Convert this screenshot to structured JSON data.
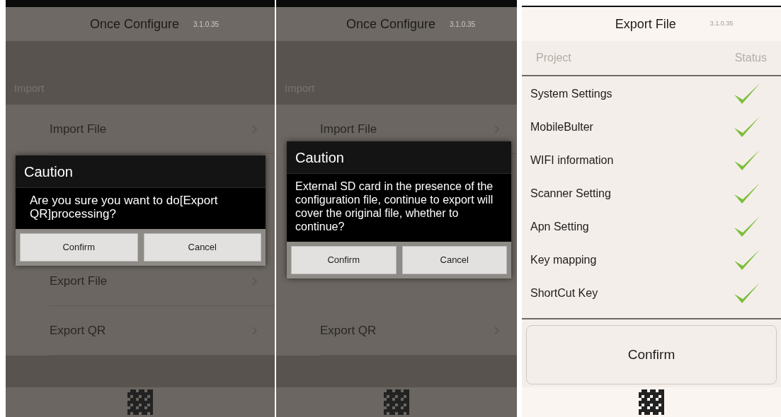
{
  "screens": [
    {
      "kind": "menu",
      "title": "Once Configure",
      "version": "3.1.0.35",
      "section": "Import",
      "upper": [
        "Import File"
      ],
      "lower": [
        "Export File",
        "Export QR"
      ],
      "dialog": {
        "title": "Caution",
        "message": "Are you sure you want to do[Export QR]processing?",
        "buttons": [
          "Confirm",
          "Cancel"
        ]
      }
    },
    {
      "kind": "menu",
      "title": "Once Configure",
      "version": "3.1.0.35",
      "section": "Import",
      "upper": [
        "Import File"
      ],
      "lower": [
        "Export QR"
      ],
      "dialog": {
        "title": "Caution",
        "message": "External SD card in the presence of the configuration file, continue to export will cover the original file, whether to continue?",
        "buttons": [
          "Confirm",
          "Cancel"
        ]
      }
    },
    {
      "kind": "export",
      "title": "Export File",
      "version": "3.1.0.35",
      "columns": [
        "Project",
        "Status"
      ],
      "rows": [
        {
          "label": "System Settings",
          "done": true
        },
        {
          "label": "MobileBulter",
          "done": true
        },
        {
          "label": "WIFI information",
          "done": true
        },
        {
          "label": "Scanner Setting",
          "done": true
        },
        {
          "label": "Apn Setting",
          "done": true
        },
        {
          "label": "Key mapping",
          "done": true
        },
        {
          "label": "ShortCut Key",
          "done": true
        }
      ],
      "button": "Confirm"
    }
  ]
}
